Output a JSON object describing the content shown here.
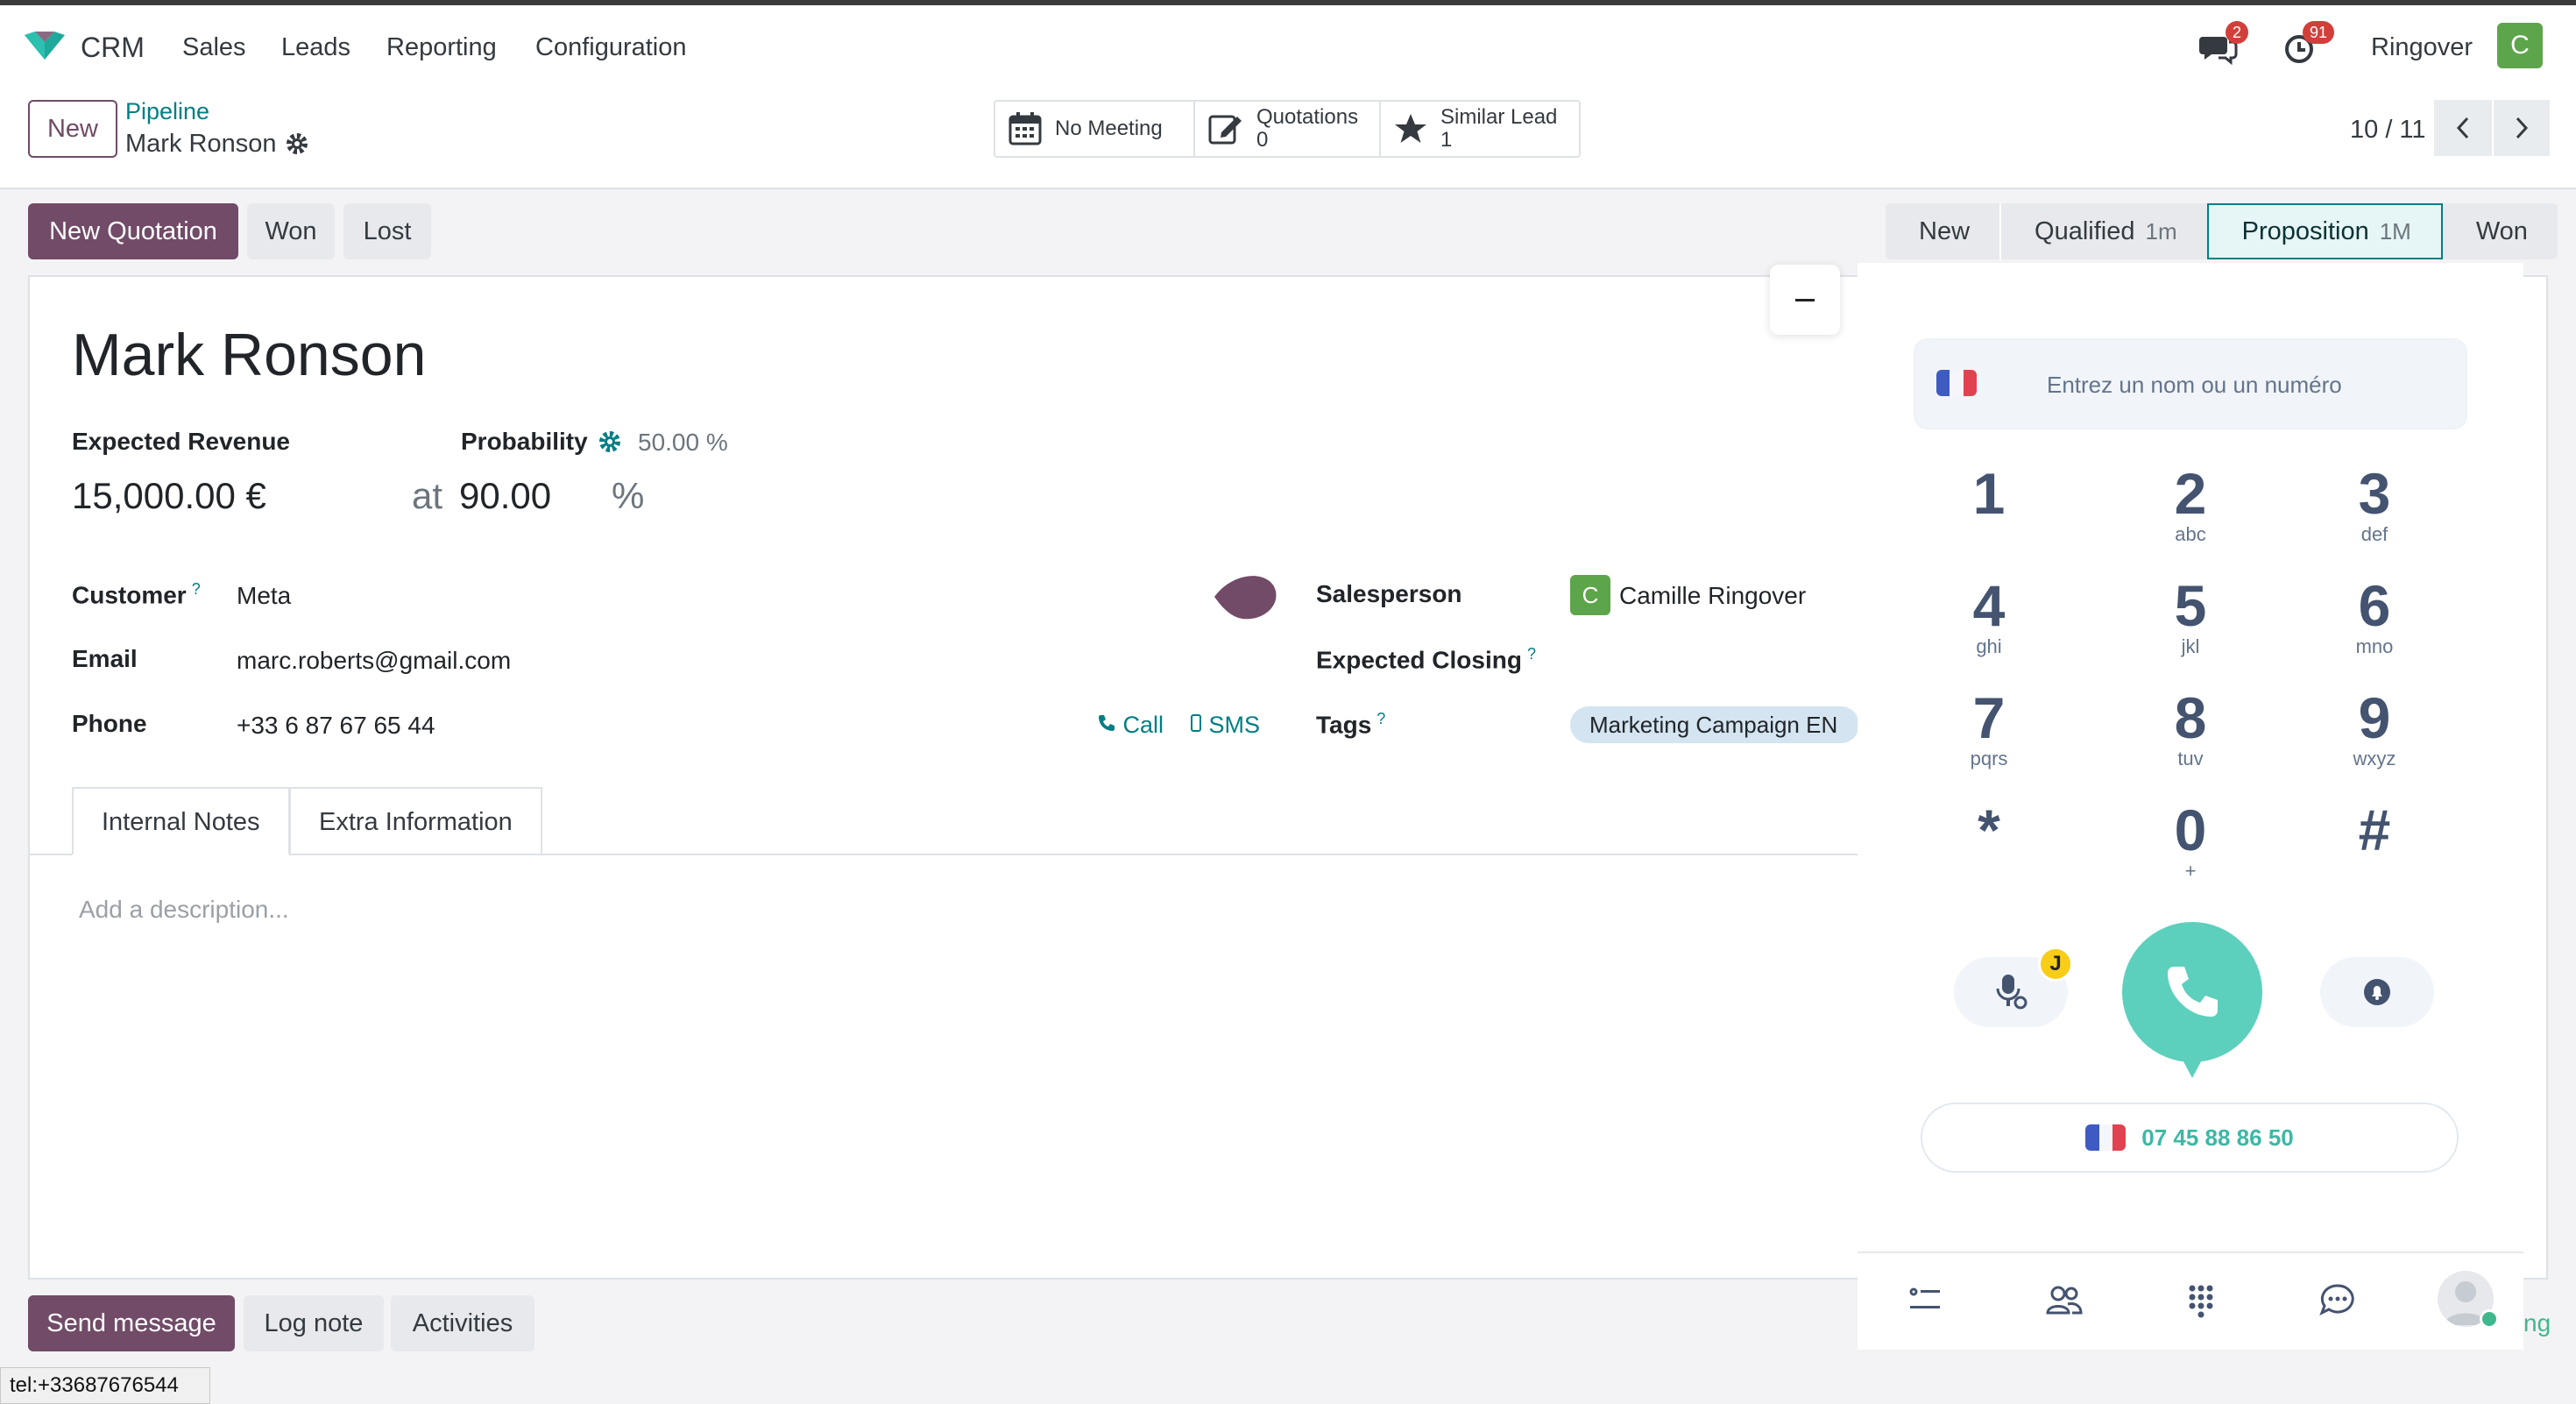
{
  "navbar": {
    "app_name": "CRM",
    "menu": [
      "Sales",
      "Leads",
      "Reporting",
      "Configuration"
    ],
    "messages_badge": "2",
    "activities_badge": "91",
    "user_name": "Ringover",
    "user_initial": "C"
  },
  "control_panel": {
    "new_label": "New",
    "breadcrumb_parent": "Pipeline",
    "breadcrumb_current": "Mark Ronson",
    "smart_buttons": {
      "meeting": "No Meeting",
      "quotations_label": "Quotations",
      "quotations_count": "0",
      "similar_label": "Similar Lead",
      "similar_count": "1"
    },
    "pager": "10 / 11"
  },
  "actions": {
    "new_quotation": "New Quotation",
    "won": "Won",
    "lost": "Lost"
  },
  "status_bar": {
    "stages": [
      {
        "label": "New",
        "time": ""
      },
      {
        "label": "Qualified",
        "time": "1m"
      },
      {
        "label": "Proposition",
        "time": "1M"
      },
      {
        "label": "Won",
        "time": ""
      }
    ],
    "active_stage": "Proposition"
  },
  "lead": {
    "title": "Mark Ronson",
    "expected_revenue_label": "Expected Revenue",
    "expected_revenue": "15,000.00 €",
    "probability_label": "Probability",
    "probability_auto": "50.00 %",
    "at_label": "at",
    "probability_value": "90.00",
    "percent_sign": "%",
    "customer_label": "Customer",
    "customer": "Meta",
    "email_label": "Email",
    "email": "marc.roberts@gmail.com",
    "phone_label": "Phone",
    "phone": "+33 6 87 67 65 44",
    "call_label": "Call",
    "sms_label": "SMS",
    "salesperson_label": "Salesperson",
    "salesperson_initial": "C",
    "salesperson": "Camille Ringover",
    "expected_closing_label": "Expected Closing",
    "tags_label": "Tags",
    "tag": "Marketing Campaign EN",
    "help_mark": "?",
    "priority_color": "#714b67"
  },
  "tabs": {
    "internal_notes": "Internal Notes",
    "extra_information": "Extra Information",
    "description_placeholder": "Add a description..."
  },
  "chatter": {
    "send_message": "Send message",
    "log_note": "Log note",
    "activities": "Activities",
    "cut_text": "ng"
  },
  "status_tooltip": "tel:+33687676544",
  "dialer": {
    "placeholder": "Entrez un nom ou un numéro",
    "keys": [
      {
        "digit": "1",
        "sub": ""
      },
      {
        "digit": "2",
        "sub": "abc"
      },
      {
        "digit": "3",
        "sub": "def"
      },
      {
        "digit": "4",
        "sub": "ghi"
      },
      {
        "digit": "5",
        "sub": "jkl"
      },
      {
        "digit": "6",
        "sub": "mno"
      },
      {
        "digit": "7",
        "sub": "pqrs"
      },
      {
        "digit": "8",
        "sub": "tuv"
      },
      {
        "digit": "9",
        "sub": "wxyz"
      },
      {
        "digit": "*",
        "sub": ""
      },
      {
        "digit": "0",
        "sub": "+"
      },
      {
        "digit": "#",
        "sub": ""
      }
    ],
    "j_badge": "J",
    "caller_number": "07 45 88 86 50",
    "accent_color": "#5dcfbd"
  },
  "colors": {
    "brand": "#714b67",
    "teal": "#017e84"
  }
}
